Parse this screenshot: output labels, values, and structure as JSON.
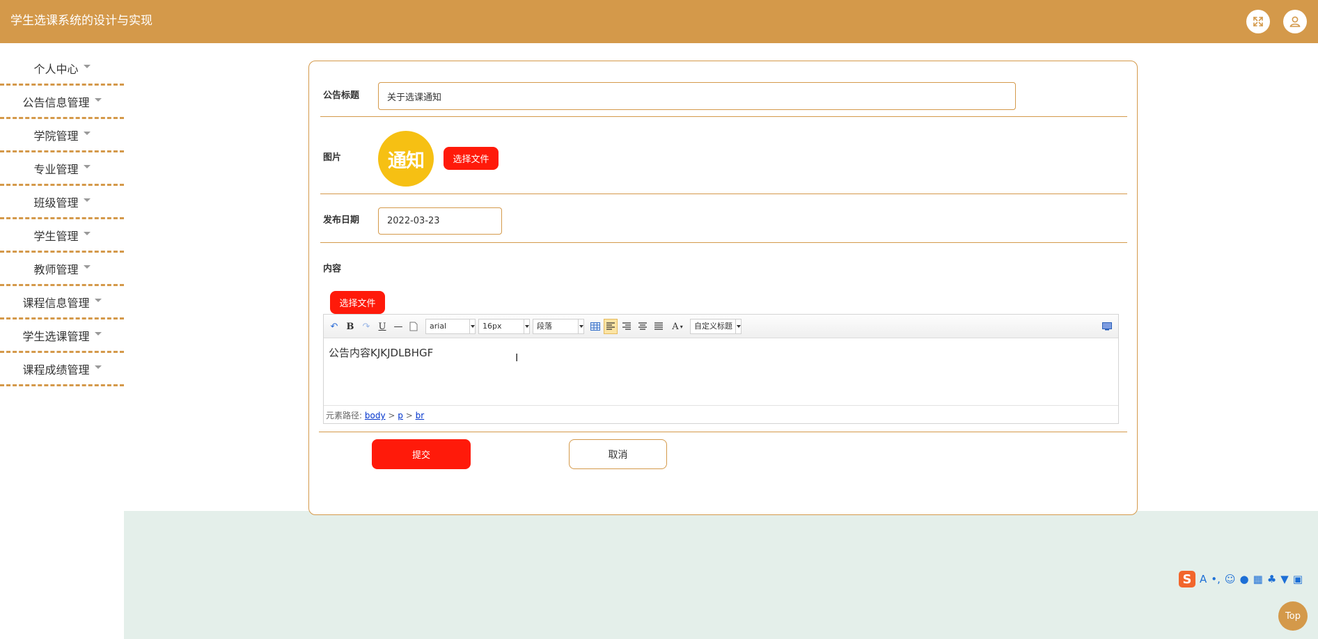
{
  "app": {
    "title": "学生选课系统的设计与实现"
  },
  "header": {
    "fullscreen_icon": "fullscreen-icon",
    "user_icon": "user-icon"
  },
  "sidebar": {
    "items": [
      {
        "label": "个人中心"
      },
      {
        "label": "公告信息管理"
      },
      {
        "label": "学院管理"
      },
      {
        "label": "专业管理"
      },
      {
        "label": "班级管理"
      },
      {
        "label": "学生管理"
      },
      {
        "label": "教师管理"
      },
      {
        "label": "课程信息管理"
      },
      {
        "label": "学生选课管理"
      },
      {
        "label": "课程成绩管理"
      }
    ]
  },
  "form": {
    "title_label": "公告标题",
    "title_value": "关于选课通知",
    "image_label": "图片",
    "image_badge_text": "通知",
    "choose_file_label": "选择文件",
    "date_label": "发布日期",
    "date_value": "2022-03-23",
    "content_label": "内容",
    "content_choose_file_label": "选择文件"
  },
  "editor": {
    "font_family": "arial",
    "font_size": "16px",
    "paragraph": "段落",
    "custom_title": "自定义标题",
    "content": "公告内容KJKJDLBHGF",
    "path_label": "元素路径:",
    "path": [
      "body",
      "p",
      "br"
    ],
    "path_sep": ">"
  },
  "actions": {
    "submit_label": "提交",
    "cancel_label": "取消"
  },
  "ime": {
    "logo": "S"
  },
  "top_button": {
    "label": "Top"
  },
  "colors": {
    "accent": "#D4994A",
    "danger": "#FF1A0A",
    "badge": "#F6C013",
    "footer_bg": "#E4EFEA"
  }
}
